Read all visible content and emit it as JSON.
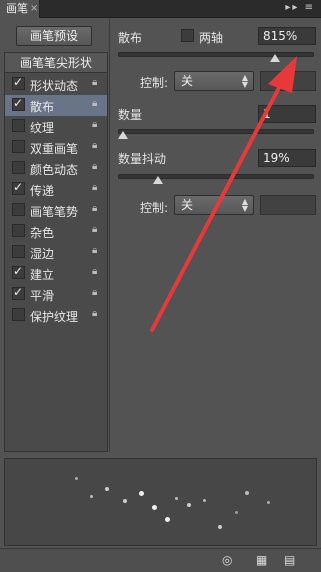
{
  "panel": {
    "tab_title": "画笔",
    "tab_close": "×",
    "menu_icons": "▸▸ ≡"
  },
  "preset_button": "画笔预设",
  "left_panel": {
    "header": "画笔笔尖形状",
    "items": [
      {
        "label": "形状动态",
        "checked": true
      },
      {
        "label": "散布",
        "checked": true,
        "selected": true
      },
      {
        "label": "纹理",
        "checked": false
      },
      {
        "label": "双重画笔",
        "checked": false
      },
      {
        "label": "颜色动态",
        "checked": false
      },
      {
        "label": "传递",
        "checked": true
      },
      {
        "label": "画笔笔势",
        "checked": false
      },
      {
        "label": "杂色",
        "checked": false
      },
      {
        "label": "湿边",
        "checked": false
      },
      {
        "label": "建立",
        "checked": true
      },
      {
        "label": "平滑",
        "checked": true
      },
      {
        "label": "保护纹理",
        "checked": false
      }
    ]
  },
  "scatter": {
    "label": "散布",
    "both_axes_label": "两轴",
    "both_axes_checked": false,
    "value": "815%",
    "slider_fraction": 0.815
  },
  "control1": {
    "label": "控制:",
    "value": "关"
  },
  "count": {
    "label": "数量",
    "value": "1",
    "slider_fraction": 0.0
  },
  "count_jitter": {
    "label": "数量抖动",
    "value": "19%",
    "slider_fraction": 0.19
  },
  "control2": {
    "label": "控制:",
    "value": "关"
  },
  "annotation": {
    "color": "#e8393a"
  },
  "footer_icons": [
    "eye-icon",
    "grid-icon",
    "new-page-icon"
  ]
}
